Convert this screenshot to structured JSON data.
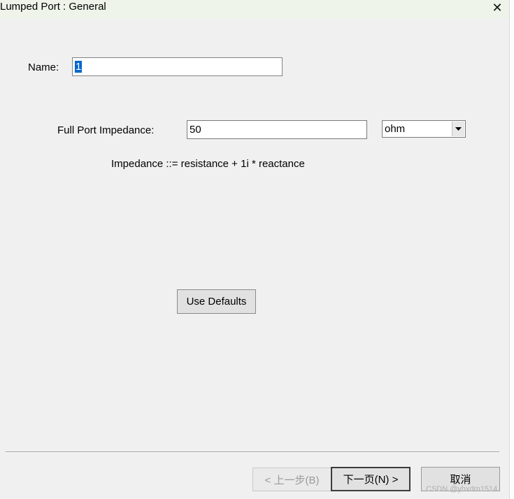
{
  "window": {
    "title": "Lumped Port : General",
    "close_glyph": "✕"
  },
  "form": {
    "name_label": "Name:",
    "name_value": "1",
    "impedance_label": "Full Port Impedance:",
    "impedance_value": "50",
    "unit_value": "ohm",
    "formula_text": "Impedance ::= resistance + 1i * reactance",
    "use_defaults_label": "Use Defaults"
  },
  "footer": {
    "back_label": "< 上一步(B)",
    "next_label": "下一页(N) >",
    "cancel_label": "取消"
  },
  "watermark": "CSDN @yhxdm1514",
  "icons": {
    "close": "close-icon",
    "dropdown": "chevron-down-icon"
  }
}
